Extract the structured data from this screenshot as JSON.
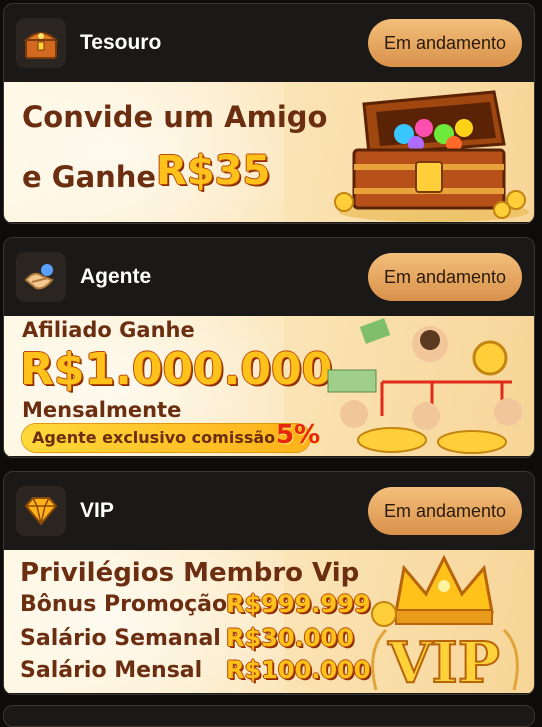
{
  "cards": [
    {
      "title": "Tesouro",
      "status": "Em andamento",
      "icon": "treasure-chest-icon",
      "banner": {
        "line1": "Convide um Amigo",
        "line2": "e Ganhe",
        "amount": "R$35"
      }
    },
    {
      "title": "Agente",
      "status": "Em andamento",
      "icon": "handshake-icon",
      "banner": {
        "line1": "Afiliado Ganhe",
        "amount": "R$1.000.000",
        "line2": "Mensalmente",
        "pill_text": "Agente exclusivo comissão",
        "pill_pct": "5%"
      }
    },
    {
      "title": "VIP",
      "status": "Em andamento",
      "icon": "diamond-icon",
      "banner": {
        "heading": "Privilégios Membro Vip",
        "rows": [
          {
            "label": "Bônus Promoção",
            "value": "R$999.999"
          },
          {
            "label": "Salário Semanal",
            "value": "R$30.000"
          },
          {
            "label": "Salário Mensal",
            "value": "R$100.000"
          }
        ],
        "crown_text": "VIP"
      }
    }
  ],
  "colors": {
    "button": "#e8a862",
    "card": "#1b1917",
    "banner_text": "#6b2e10",
    "gold": "#ffc21a"
  }
}
